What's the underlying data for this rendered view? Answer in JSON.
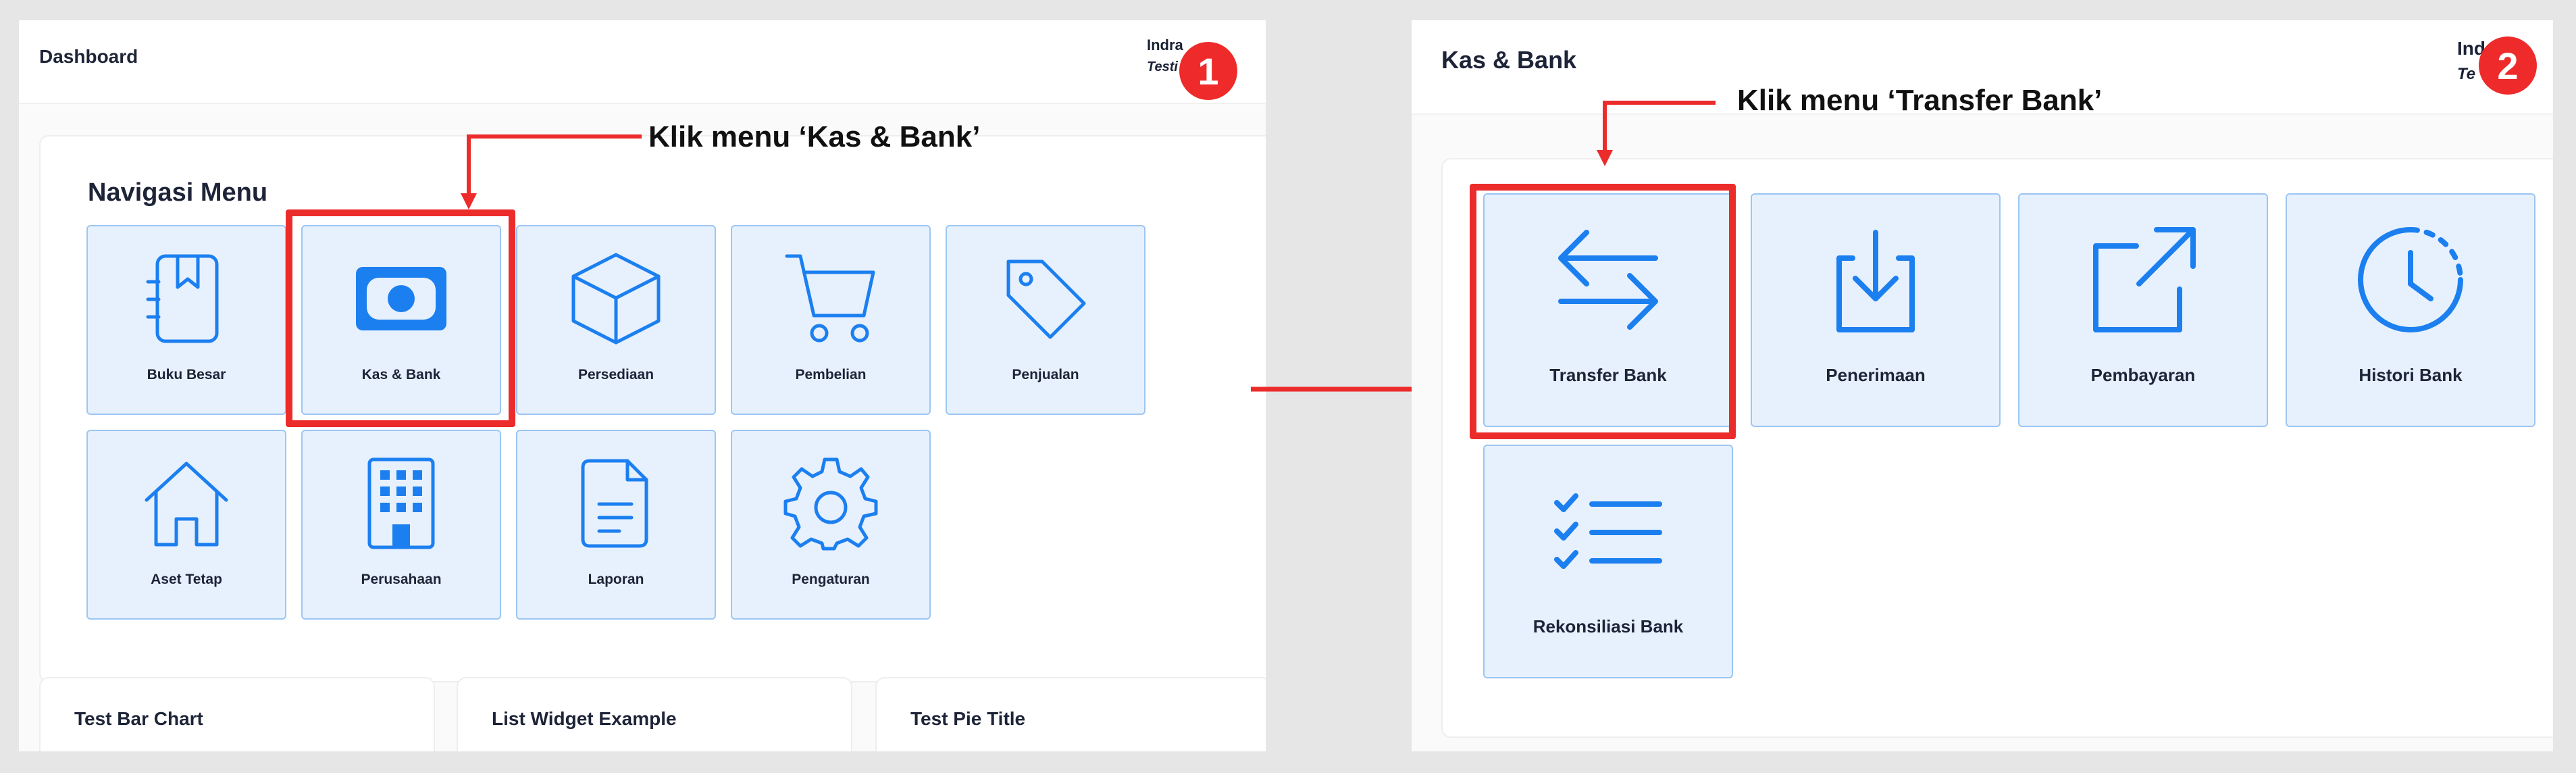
{
  "left_screen": {
    "header_title": "Dashboard",
    "user_name": "Indra",
    "company": "Testi",
    "section_title": "Navigasi Menu",
    "tiles": [
      {
        "label": "Buku Besar",
        "icon": "ledger-book-icon"
      },
      {
        "label": "Kas & Bank",
        "icon": "banknote-icon"
      },
      {
        "label": "Persediaan",
        "icon": "box-icon"
      },
      {
        "label": "Pembelian",
        "icon": "cart-icon"
      },
      {
        "label": "Penjualan",
        "icon": "tag-icon"
      },
      {
        "label": "Aset Tetap",
        "icon": "house-icon"
      },
      {
        "label": "Perusahaan",
        "icon": "building-icon"
      },
      {
        "label": "Laporan",
        "icon": "document-icon"
      },
      {
        "label": "Pengaturan",
        "icon": "gear-icon"
      }
    ],
    "widgets": [
      "Test Bar Chart",
      "List Widget Example",
      "Test Pie Title"
    ]
  },
  "right_screen": {
    "header_title": "Kas & Bank",
    "user_name": "Ind",
    "company": "Te",
    "tiles": [
      {
        "label": "Transfer Bank",
        "icon": "transfer-arrows-icon"
      },
      {
        "label": "Penerimaan",
        "icon": "download-tray-icon"
      },
      {
        "label": "Pembayaran",
        "icon": "external-link-icon"
      },
      {
        "label": "Histori Bank",
        "icon": "clock-history-icon"
      },
      {
        "label": "Rekonsiliasi Bank",
        "icon": "checklist-icon"
      }
    ]
  },
  "annotations": {
    "step1_text": "Klik menu ‘Kas & Bank’",
    "step2_text": "Klik menu ‘Transfer Bank’",
    "step1_number": "1",
    "step2_number": "2",
    "highlight_color": "#ec2b2b",
    "accent_color": "#1c7ff0"
  }
}
